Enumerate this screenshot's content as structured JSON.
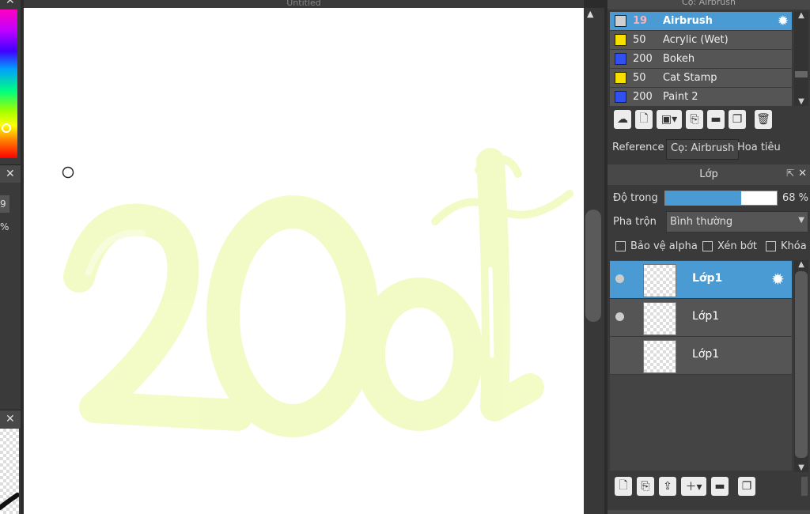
{
  "canvas": {
    "title": "Untitled",
    "text_drawn": "20d",
    "stroke_color": "#f2fbc4"
  },
  "brush_panel": {
    "title": "Cọ: Airbrush",
    "brushes": [
      {
        "size": "19",
        "name": "Airbrush",
        "color": "#cfcfcf",
        "selected": true
      },
      {
        "size": "50",
        "name": "Acrylic (Wet)",
        "color": "#f5e000",
        "selected": false
      },
      {
        "size": "200",
        "name": "Bokeh",
        "color": "#3050f0",
        "selected": false
      },
      {
        "size": "50",
        "name": "Cat Stamp",
        "color": "#f5e000",
        "selected": false
      },
      {
        "size": "200",
        "name": "Paint 2",
        "color": "#3050f0",
        "selected": false
      }
    ],
    "toolbar_icons": [
      "cloud-upload-icon",
      "new-brush-icon",
      "brush-options-icon",
      "copy-brush-icon",
      "folder-icon",
      "duplicate-icon",
      "trash-icon"
    ]
  },
  "tabs": [
    {
      "label": "Reference",
      "active": false
    },
    {
      "label": "Cọ: Airbrush",
      "active": true
    },
    {
      "label": "Hoa tiêu",
      "active": false
    }
  ],
  "layer_panel": {
    "title": "Lớp",
    "opacity_label": "Độ trong",
    "opacity_value": "68 %",
    "opacity_fraction": 0.68,
    "blend_label": "Pha trộn",
    "blend_value": "Bình thường",
    "checks": [
      {
        "label": "Bảo vệ alpha"
      },
      {
        "label": "Xén bớt"
      },
      {
        "label": "Khóa"
      }
    ],
    "layers": [
      {
        "name": "Lớp1",
        "selected": true,
        "visible": true
      },
      {
        "name": "Lớp1",
        "selected": false,
        "visible": true
      },
      {
        "name": "Lớp1",
        "selected": false,
        "visible": false
      }
    ]
  },
  "left_panel": {
    "value_partial": "9",
    "percent_partial": "%"
  },
  "colors": {
    "accent": "#4a9ad4",
    "panel": "#3a3a3a",
    "row": "#555555"
  }
}
